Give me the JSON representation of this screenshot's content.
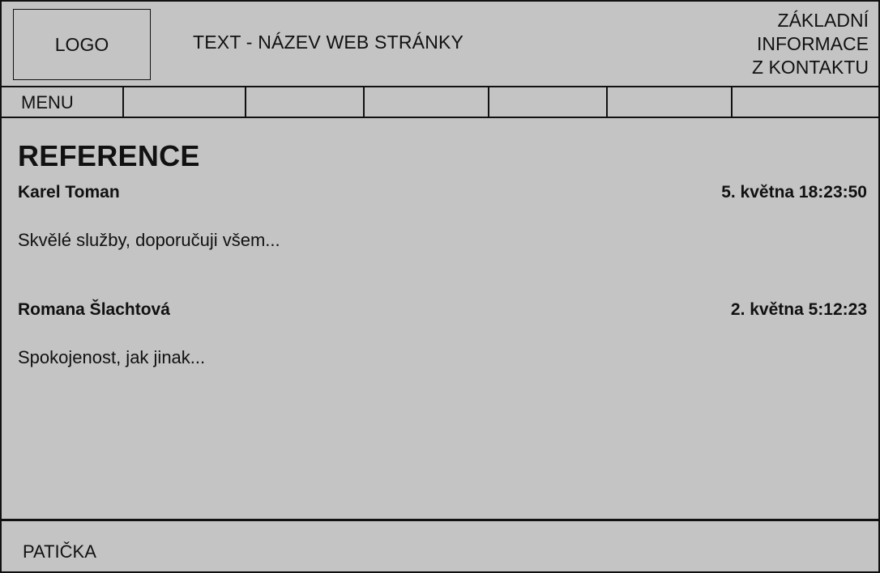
{
  "header": {
    "logo_text": "LOGO",
    "site_title": "TEXT - NÁZEV WEB STRÁNKY",
    "contact_lines": [
      "ZÁKLADNÍ",
      "INFORMACE",
      "Z KONTAKTU"
    ]
  },
  "menu": {
    "items": [
      {
        "label": "MENU"
      },
      {
        "label": ""
      },
      {
        "label": ""
      },
      {
        "label": ""
      },
      {
        "label": ""
      },
      {
        "label": ""
      },
      {
        "label": ""
      }
    ]
  },
  "main": {
    "heading": "REFERENCE",
    "reviews": [
      {
        "author": "Karel Toman",
        "date": "5. května 18:23:50",
        "text": "Skvělé služby, doporučuji všem..."
      },
      {
        "author": "Romana Šlachtová",
        "date": "2. května 5:12:23",
        "text": "Spokojenost, jak jinak..."
      }
    ]
  },
  "footer": {
    "label": "PATIČKA"
  }
}
